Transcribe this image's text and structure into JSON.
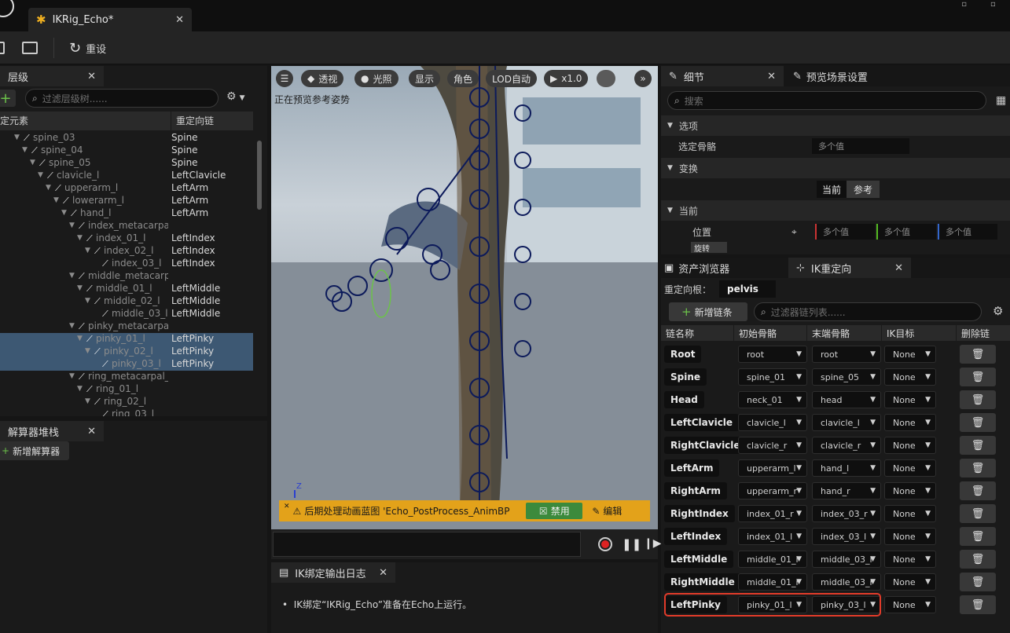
{
  "window": {
    "tab_title": "IKRig_Echo*"
  },
  "toolbar": {
    "reset_label": "重设"
  },
  "hierarchy": {
    "tab_label": "层级",
    "search_placeholder": "过滤层级树......",
    "col_element": "定元素",
    "col_chain": "重定向链",
    "rows": [
      {
        "name": "spine_03",
        "chain": "Spine",
        "depth": 0,
        "expanded": true,
        "selected": false
      },
      {
        "name": "spine_04",
        "chain": "Spine",
        "depth": 1,
        "expanded": true,
        "selected": false
      },
      {
        "name": "spine_05",
        "chain": "Spine",
        "depth": 2,
        "expanded": true,
        "selected": false
      },
      {
        "name": "clavicle_l",
        "chain": "LeftClavicle",
        "depth": 3,
        "expanded": true,
        "selected": false
      },
      {
        "name": "upperarm_l",
        "chain": "LeftArm",
        "depth": 4,
        "expanded": true,
        "selected": false
      },
      {
        "name": "lowerarm_l",
        "chain": "LeftArm",
        "depth": 5,
        "expanded": true,
        "selected": false
      },
      {
        "name": "hand_l",
        "chain": "LeftArm",
        "depth": 6,
        "expanded": true,
        "selected": false
      },
      {
        "name": "index_metacarpa",
        "chain": "",
        "depth": 7,
        "expanded": true,
        "selected": false
      },
      {
        "name": "index_01_l",
        "chain": "LeftIndex",
        "depth": 8,
        "expanded": true,
        "selected": false
      },
      {
        "name": "index_02_l",
        "chain": "LeftIndex",
        "depth": 9,
        "expanded": true,
        "selected": false
      },
      {
        "name": "index_03_l",
        "chain": "LeftIndex",
        "depth": 10,
        "expanded": false,
        "selected": false
      },
      {
        "name": "middle_metacarp",
        "chain": "",
        "depth": 7,
        "expanded": true,
        "selected": false
      },
      {
        "name": "middle_01_l",
        "chain": "LeftMiddle",
        "depth": 8,
        "expanded": true,
        "selected": false
      },
      {
        "name": "middle_02_l",
        "chain": "LeftMiddle",
        "depth": 9,
        "expanded": true,
        "selected": false
      },
      {
        "name": "middle_03_l",
        "chain": "LeftMiddle",
        "depth": 10,
        "expanded": false,
        "selected": false
      },
      {
        "name": "pinky_metacarpa",
        "chain": "",
        "depth": 7,
        "expanded": true,
        "selected": false
      },
      {
        "name": "pinky_01_l",
        "chain": "LeftPinky",
        "depth": 8,
        "expanded": true,
        "selected": true
      },
      {
        "name": "pinky_02_l",
        "chain": "LeftPinky",
        "depth": 9,
        "expanded": true,
        "selected": true
      },
      {
        "name": "pinky_03_l",
        "chain": "LeftPinky",
        "depth": 10,
        "expanded": false,
        "selected": true
      },
      {
        "name": "ring_metacarpal_",
        "chain": "",
        "depth": 7,
        "expanded": true,
        "selected": false
      },
      {
        "name": "ring_01_l",
        "chain": "",
        "depth": 8,
        "expanded": true,
        "selected": false
      },
      {
        "name": "ring_02_l",
        "chain": "",
        "depth": 9,
        "expanded": true,
        "selected": false
      },
      {
        "name": "ring_03_l",
        "chain": "",
        "depth": 10,
        "expanded": false,
        "selected": false
      }
    ]
  },
  "solver": {
    "tab_label": "解算器堆栈",
    "add_label": "新增解算器"
  },
  "viewport": {
    "btn_perspective": "透视",
    "btn_lit": "光照",
    "btn_show": "显示",
    "btn_character": "角色",
    "btn_lod": "LOD自动",
    "btn_speed": "x1.0",
    "preview_text": "正在预览参考姿势",
    "warning_text": "后期处理动画蓝图 'Echo_PostProcess_AnimBP",
    "disable_label": "禁用",
    "edit_label": "编辑",
    "axis_label": "Z"
  },
  "log": {
    "tab_label": "IK绑定输出日志",
    "message": "IK绑定“IKRig_Echo”准备在Echo上运行。"
  },
  "details": {
    "tab_label": "细节",
    "preview_tab_label": "预览场景设置",
    "search_placeholder": "搜索",
    "section_options": "选项",
    "selected_bone_label": "选定骨骼",
    "selected_bone_value": "多个值",
    "section_transform": "变换",
    "toggle_current": "当前",
    "toggle_reference": "参考",
    "section_current": "当前",
    "location_label": "位置",
    "rotation_label": "旋转",
    "multi_value": "多个值"
  },
  "retarget": {
    "asset_tab_label": "资产浏览器",
    "tab_label": "IK重定向",
    "root_label": "重定向根：",
    "root_value": "pelvis",
    "add_chain_label": "新增链条",
    "search_placeholder": "过滤器链列表......",
    "col_chain_name": "链名称",
    "col_start_bone": "初始骨骼",
    "col_end_bone": "末端骨骼",
    "col_ik_goal": "IK目标",
    "col_delete": "删除链",
    "chains": [
      {
        "name": "Root",
        "start": "root",
        "end": "root",
        "goal": "None",
        "highlight": false
      },
      {
        "name": "Spine",
        "start": "spine_01",
        "end": "spine_05",
        "goal": "None",
        "highlight": false
      },
      {
        "name": "Head",
        "start": "neck_01",
        "end": "head",
        "goal": "None",
        "highlight": false
      },
      {
        "name": "LeftClavicle",
        "start": "clavicle_l",
        "end": "clavicle_l",
        "goal": "None",
        "highlight": false
      },
      {
        "name": "RightClavicle",
        "start": "clavicle_r",
        "end": "clavicle_r",
        "goal": "None",
        "highlight": false
      },
      {
        "name": "LeftArm",
        "start": "upperarm_l",
        "end": "hand_l",
        "goal": "None",
        "highlight": false
      },
      {
        "name": "RightArm",
        "start": "upperarm_r",
        "end": "hand_r",
        "goal": "None",
        "highlight": false
      },
      {
        "name": "RightIndex",
        "start": "index_01_r",
        "end": "index_03_r",
        "goal": "None",
        "highlight": false
      },
      {
        "name": "LeftIndex",
        "start": "index_01_l",
        "end": "index_03_l",
        "goal": "None",
        "highlight": false
      },
      {
        "name": "LeftMiddle",
        "start": "middle_01_l",
        "end": "middle_03_l",
        "goal": "None",
        "highlight": false
      },
      {
        "name": "RightMiddle",
        "start": "middle_01_r",
        "end": "middle_03_r",
        "goal": "None",
        "highlight": false
      },
      {
        "name": "LeftPinky",
        "start": "pinky_01_l",
        "end": "pinky_03_l",
        "goal": "None",
        "highlight": true
      }
    ]
  },
  "colors": {
    "accent_green": "#6cc24a",
    "warning": "#e3a21a",
    "selection": "#3d5873",
    "highlight_outline": "#e23b2a"
  }
}
